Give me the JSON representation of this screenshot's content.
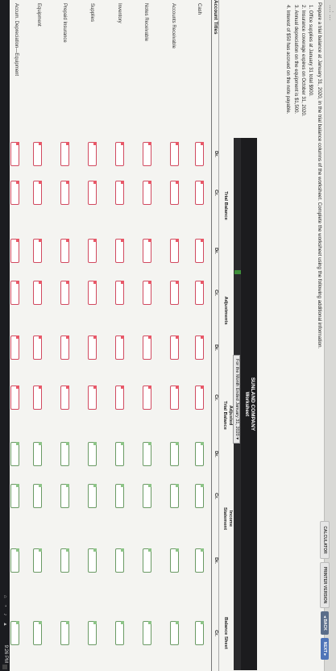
{
  "breadcrumb": "...: ...",
  "toolbar": {
    "calculator": "CALCULATOR",
    "printer": "PRINTER VERSION",
    "back": "◂ BACK",
    "next": "NEXT ▸"
  },
  "prompt": "Prepare a trial balance at January 31, 2020, in the trial balance columns of the worksheet. Complete the worksheet using the following additional information.",
  "info": [
    "1.  Office supplies at January 31 total $900.",
    "2.  Insurance coverage expires on October 31, 2020.",
    "3.  Annual depreciation on the equipment is $1,500.",
    "4.  Interest of $50 has accrued on the note payable."
  ],
  "worksheet": {
    "company": "SUNLAND COMPANY",
    "title": "Worksheet",
    "date_selected": "For the Month Ended January 31, 2020 ▾"
  },
  "headers": {
    "account": "Account Titles",
    "groups": [
      "Trial Balance",
      "Adjustments",
      "Adjusted\nTrial Balance",
      "Income\nStatement",
      "Balance Sheet"
    ],
    "dr": "Dr.",
    "cr": "Cr."
  },
  "accounts": [
    "Cash",
    "Accounts Receivable",
    "Notes Receivable",
    "Inventory",
    "Supplies",
    "Prepaid Insurance",
    "Equipment",
    "Accum. Depreciation—Equipment"
  ],
  "taskbar": {
    "time": "9:26 PM",
    "tray": "⌂ ◔ ♪ ▲"
  }
}
